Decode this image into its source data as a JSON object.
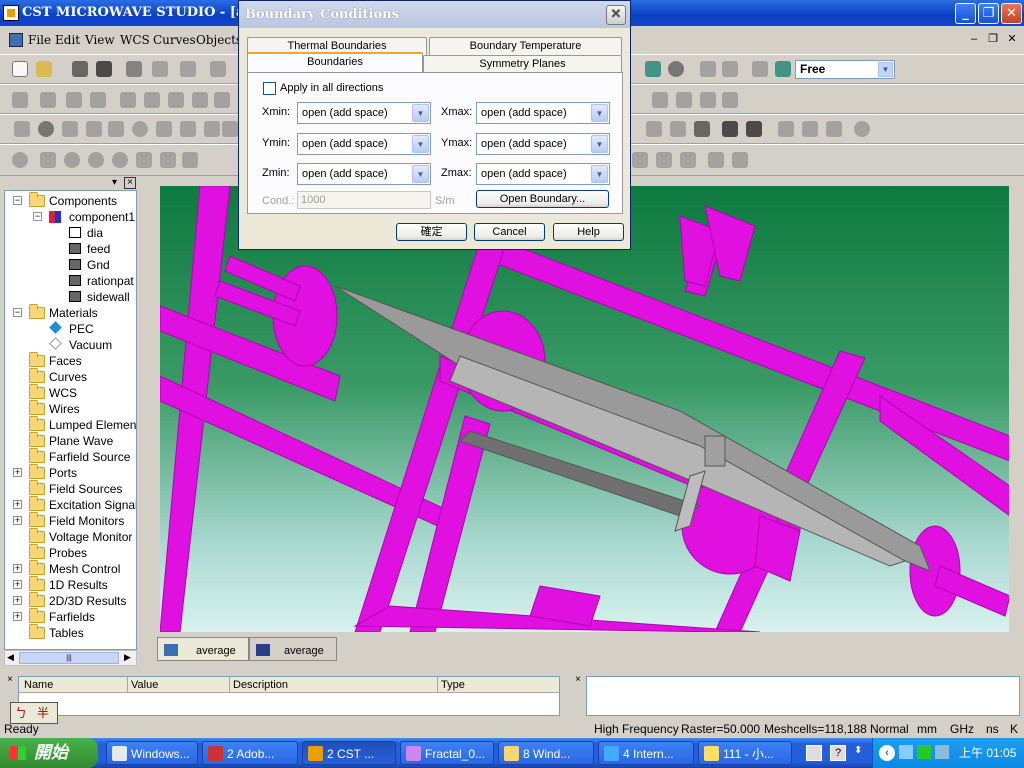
{
  "window": {
    "title": "CST MICROWAVE STUDIO - [averag",
    "min": "_",
    "max": "❐",
    "close": "✕"
  },
  "menu": {
    "items": [
      "File",
      "Edit",
      "View",
      "WCS",
      "Curves",
      "Objects"
    ],
    "mdi_min": "–",
    "mdi_restore": "❐",
    "mdi_close": "✕"
  },
  "toolbar": {
    "mode_combo": "Free"
  },
  "tree": {
    "items": [
      {
        "label": "Components",
        "exp": "−"
      },
      {
        "label": "component1",
        "exp": "−"
      },
      {
        "label": "dia"
      },
      {
        "label": "feed"
      },
      {
        "label": "Gnd"
      },
      {
        "label": "rationpat"
      },
      {
        "label": "sidewall"
      },
      {
        "label": "Materials",
        "exp": "−"
      },
      {
        "label": "PEC"
      },
      {
        "label": "Vacuum"
      },
      {
        "label": "Faces"
      },
      {
        "label": "Curves"
      },
      {
        "label": "WCS"
      },
      {
        "label": "Wires"
      },
      {
        "label": "Lumped Elemen"
      },
      {
        "label": "Plane Wave"
      },
      {
        "label": "Farfield Source"
      },
      {
        "label": "Ports",
        "exp": "+"
      },
      {
        "label": "Field Sources"
      },
      {
        "label": "Excitation Signal",
        "exp": "+"
      },
      {
        "label": "Field Monitors",
        "exp": "+"
      },
      {
        "label": "Voltage Monitor"
      },
      {
        "label": "Probes"
      },
      {
        "label": "Mesh Control",
        "exp": "+"
      },
      {
        "label": "1D Results",
        "exp": "+"
      },
      {
        "label": "2D/3D Results",
        "exp": "+"
      },
      {
        "label": "Farfields",
        "exp": "+"
      },
      {
        "label": "Tables"
      }
    ],
    "scroll_mark": "|||"
  },
  "view_tabs": [
    {
      "label": "average"
    },
    {
      "label": "average"
    }
  ],
  "params": {
    "columns": [
      "Name",
      "Value",
      "Description",
      "Type"
    ],
    "ime": [
      "ㄅ",
      "半"
    ]
  },
  "status": {
    "left": "Ready",
    "items": [
      "High Frequency",
      "Raster=50.000",
      "Meshcells=118,188",
      "Normal",
      "mm",
      "GHz",
      "ns",
      "K"
    ]
  },
  "taskbar": {
    "start": "開始",
    "tasks": [
      "Windows...",
      "2 Adob...",
      "2 CST ...",
      "Fractal_0...",
      "8 Wind...",
      "4 Intern...",
      "111 - 小..."
    ],
    "clock": "上午 01:05"
  },
  "dialog": {
    "title": "Boundary Conditions",
    "tabs_back": [
      "Thermal Boundaries",
      "Boundary Temperature"
    ],
    "tabs_front": [
      "Boundaries",
      "Symmetry Planes"
    ],
    "apply_all": "Apply in all directions",
    "rows": [
      {
        "label_min": "Xmin:",
        "value_min": "open (add space)",
        "label_max": "Xmax:",
        "value_max": "open (add space)"
      },
      {
        "label_min": "Ymin:",
        "value_min": "open (add space)",
        "label_max": "Ymax:",
        "value_max": "open (add space)"
      },
      {
        "label_min": "Zmin:",
        "value_min": "open (add space)",
        "label_max": "Zmax:",
        "value_max": "open (add space)"
      }
    ],
    "cond_label": "Cond.:",
    "cond_value": "1000",
    "cond_unit": "S/m",
    "open_boundary": "Open Boundary...",
    "ok": "確定",
    "cancel": "Cancel",
    "help": "Help"
  }
}
